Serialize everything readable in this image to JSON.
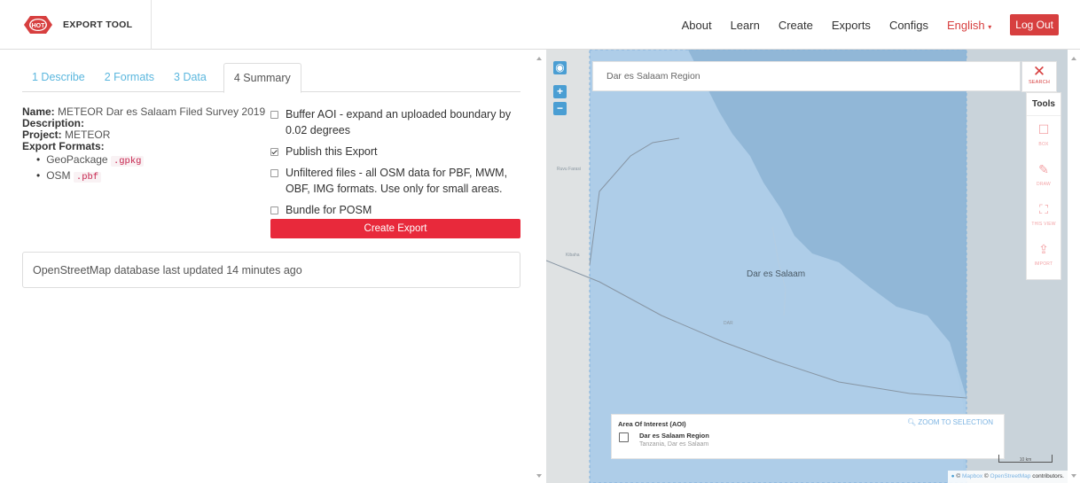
{
  "brand": {
    "logo_text": "HOT",
    "title": "EXPORT TOOL"
  },
  "nav": {
    "about": "About",
    "learn": "Learn",
    "create": "Create",
    "exports": "Exports",
    "configs": "Configs",
    "language": "English",
    "logout": "Log Out"
  },
  "colors": {
    "brand": "#d73f3f",
    "create_button": "#e8293b",
    "aoi_fill": "#9cc6e8",
    "link": "#5bb7de"
  },
  "tabs": [
    {
      "label": "1 Describe"
    },
    {
      "label": "2 Formats"
    },
    {
      "label": "3 Data"
    },
    {
      "label": "4 Summary",
      "active": true
    }
  ],
  "summary": {
    "name_label": "Name:",
    "name_value": "METEOR Dar es Salaam Filed Survey 2019",
    "description_label": "Description:",
    "project_label": "Project:",
    "project_value": "METEOR",
    "formats_label": "Export Formats:",
    "formats": [
      {
        "name": "GeoPackage",
        "ext": ".gpkg"
      },
      {
        "name": "OSM",
        "ext": ".pbf"
      }
    ]
  },
  "options": [
    {
      "label": "Buffer AOI - expand an uploaded boundary by 0.02 degrees",
      "checked": false
    },
    {
      "label": "Publish this Export",
      "checked": true
    },
    {
      "label": "Unfiltered files - all OSM data for PBF, MWM, OBF, IMG formats. Use only for small areas.",
      "checked": false
    },
    {
      "label": "Bundle for POSM",
      "checked": false
    }
  ],
  "create_button": "Create Export",
  "db_status": "OpenStreetMap database last updated 14 minutes ago",
  "map": {
    "search_value": "Dar es Salaam Region",
    "search_close_label": "SEARCH",
    "tools_title": "Tools",
    "tools": [
      {
        "label": "BOX",
        "icon": "square-icon"
      },
      {
        "label": "DRAW",
        "icon": "pencil-icon"
      },
      {
        "label": "THIS VIEW",
        "icon": "expand-icon"
      },
      {
        "label": "IMPORT",
        "icon": "upload-icon"
      }
    ],
    "city_label": "Dar es Salaam",
    "place_labels": {
      "dar": "DAR",
      "kibaha": "Kibaha",
      "ruvu": "Ruvu Farasi"
    },
    "aoi": {
      "title": "Area Of Interest (AOI)",
      "zoom_label": "ZOOM TO SELECTION",
      "name": "Dar es Salaam Region",
      "location": "Tanzania, Dar es Salaam"
    },
    "scale": "10 km",
    "attribution": {
      "mapbox": "Mapbox",
      "osm": "OpenStreetMap",
      "suffix": "contributors."
    }
  }
}
